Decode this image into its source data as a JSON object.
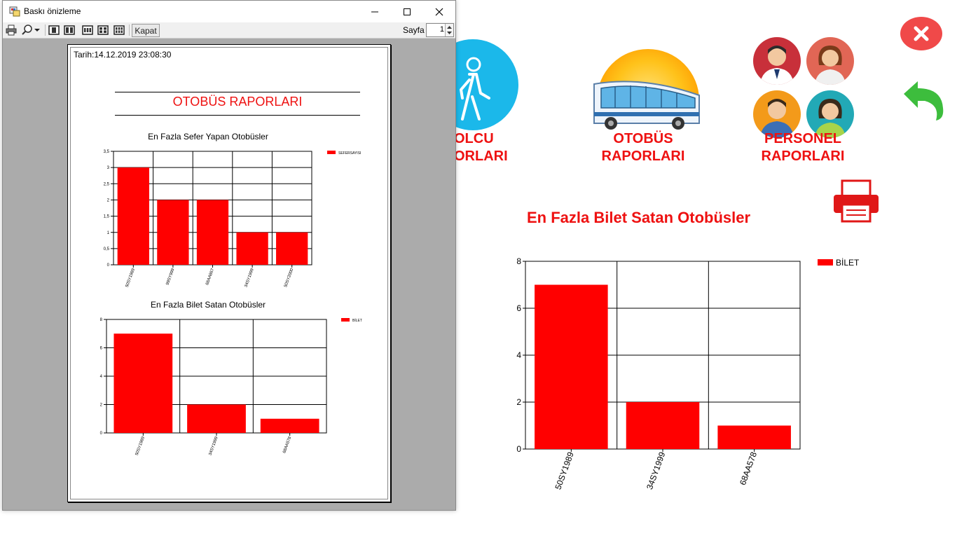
{
  "app": {
    "nav": {
      "passenger_line1": "OLCU",
      "passenger_line2": "ORLARI",
      "bus_line1": "OTOBÜS",
      "bus_line2": "RAPORLARI",
      "staff_line1": "PERSONEL",
      "staff_line2": "RAPORLARI"
    },
    "close_icon": "close-icon",
    "back_icon": "back-arrow-icon",
    "print_icon": "printer-icon",
    "colors": {
      "accent_red": "#ee1111",
      "blue": "#1bb8ea",
      "green": "#3dbd3d",
      "close_red": "#f04949"
    }
  },
  "preview_window": {
    "title": "Baskı önizleme",
    "close_label": "Kapat",
    "page_label": "Sayfa",
    "page_number": "1",
    "document": {
      "date_line": "Tarih:14.12.2019 23:08:30",
      "heading": "OTOBÜS RAPORLARI"
    }
  },
  "chart_data": [
    {
      "id": "preview-chart-1",
      "type": "bar",
      "title": "En Fazla Sefer Yapan Otobüsler",
      "categories": [
        "50SY1989",
        "99SY999",
        "68AA867",
        "34SY1999",
        "50SY2000"
      ],
      "series": [
        {
          "name": "SEFERSAYISI",
          "values": [
            3,
            2,
            2,
            1,
            1
          ]
        }
      ],
      "ylim": [
        0,
        3.5
      ],
      "yticks": [
        "0",
        "0,5",
        "1",
        "1,5",
        "2",
        "2,5",
        "3",
        "3,5"
      ],
      "grid": true,
      "legend": "top-right"
    },
    {
      "id": "preview-chart-2",
      "type": "bar",
      "title": "En Fazla Bilet Satan Otobüsler",
      "categories": [
        "50SY1989",
        "34SY1999",
        "68AA578"
      ],
      "series": [
        {
          "name": "BİLET",
          "values": [
            7,
            2,
            1
          ]
        }
      ],
      "ylim": [
        0,
        8
      ],
      "yticks": [
        "0",
        "2",
        "4",
        "6",
        "8"
      ],
      "grid": true,
      "legend": "top-right"
    },
    {
      "id": "main-chart",
      "type": "bar",
      "title": "En Fazla Bilet Satan Otobüsler",
      "categories": [
        "50SY1989",
        "34SY1999",
        "68AA578"
      ],
      "series": [
        {
          "name": "BİLET",
          "values": [
            7,
            2,
            1
          ]
        }
      ],
      "ylim": [
        0,
        8
      ],
      "yticks": [
        "0",
        "2",
        "4",
        "6",
        "8"
      ],
      "grid": true,
      "legend": "top-right"
    }
  ]
}
